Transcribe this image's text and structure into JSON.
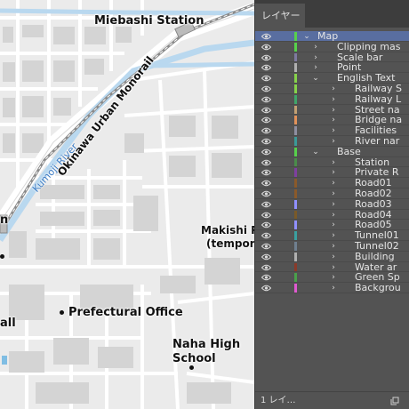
{
  "map": {
    "labels": {
      "miebashi": "Miebashi Station",
      "monorail": "Okinawa Urban Monorail",
      "river": "Kumoji River",
      "makishi_1": "Makishi P",
      "makishi_2": "(tempora",
      "prefectural": "Prefectural Office",
      "naha_1": "Naha High",
      "naha_2": "School",
      "left_all": "all",
      "left_n": "n"
    }
  },
  "panel": {
    "tab_label": "レイヤー",
    "footer_label": "1 レイ…",
    "layers": [
      {
        "name": "Map",
        "level": 0,
        "twisty": "open",
        "color": "#57d14b",
        "selected": true
      },
      {
        "name": "Clipping mas",
        "level": 1,
        "twisty": "closed",
        "color": "#57d14b",
        "selected": false
      },
      {
        "name": "Scale bar",
        "level": 1,
        "twisty": "closed",
        "color": "#7e7aa0",
        "selected": false
      },
      {
        "name": "Point",
        "level": 1,
        "twisty": "closed",
        "color": "#b0b0b0",
        "selected": false
      },
      {
        "name": "English Text",
        "level": 1,
        "twisty": "open",
        "color": "#86d34a",
        "selected": false
      },
      {
        "name": "Railway S",
        "level": 2,
        "twisty": "closed",
        "color": "#86d34a",
        "selected": false
      },
      {
        "name": "Railway L",
        "level": 2,
        "twisty": "closed",
        "color": "#3fa56a",
        "selected": false
      },
      {
        "name": "Street na",
        "level": 2,
        "twisty": "closed",
        "color": "#c2a074",
        "selected": false
      },
      {
        "name": "Bridge na",
        "level": 2,
        "twisty": "closed",
        "color": "#e2925a",
        "selected": false
      },
      {
        "name": "Facilities",
        "level": 2,
        "twisty": "closed",
        "color": "#8e8ea0",
        "selected": false
      },
      {
        "name": "River nar",
        "level": 2,
        "twisty": "closed",
        "color": "#3a9a98",
        "selected": false
      },
      {
        "name": "Base",
        "level": 1,
        "twisty": "open",
        "color": "#57d14b",
        "selected": false
      },
      {
        "name": "Station",
        "level": 2,
        "twisty": "closed",
        "color": "#4a8c4a",
        "selected": false
      },
      {
        "name": "Private R",
        "level": 2,
        "twisty": "closed",
        "color": "#7f3fa0",
        "selected": false
      },
      {
        "name": "Road01",
        "level": 2,
        "twisty": "closed",
        "color": "#8a5a2a",
        "selected": false
      },
      {
        "name": "Road02",
        "level": 2,
        "twisty": "closed",
        "color": "#8a5a2a",
        "selected": false
      },
      {
        "name": "Road03",
        "level": 2,
        "twisty": "closed",
        "color": "#9090ff",
        "selected": false
      },
      {
        "name": "Road04",
        "level": 2,
        "twisty": "closed",
        "color": "#7a5a28",
        "selected": false
      },
      {
        "name": "Road05",
        "level": 2,
        "twisty": "closed",
        "color": "#9090ff",
        "selected": false
      },
      {
        "name": "Tunnel01",
        "level": 2,
        "twisty": "closed",
        "color": "#3aa0a0",
        "selected": false
      },
      {
        "name": "Tunnel02",
        "level": 2,
        "twisty": "closed",
        "color": "#708090",
        "selected": false
      },
      {
        "name": "Building",
        "level": 2,
        "twisty": "closed",
        "color": "#b0b0b0",
        "selected": false
      },
      {
        "name": "Water ar",
        "level": 2,
        "twisty": "closed",
        "color": "#8a3a2a",
        "selected": false
      },
      {
        "name": "Green Sp",
        "level": 2,
        "twisty": "closed",
        "color": "#4aa04a",
        "selected": false
      },
      {
        "name": "Backgrou",
        "level": 2,
        "twisty": "closed",
        "color": "#e05ad0",
        "selected": false
      }
    ]
  }
}
